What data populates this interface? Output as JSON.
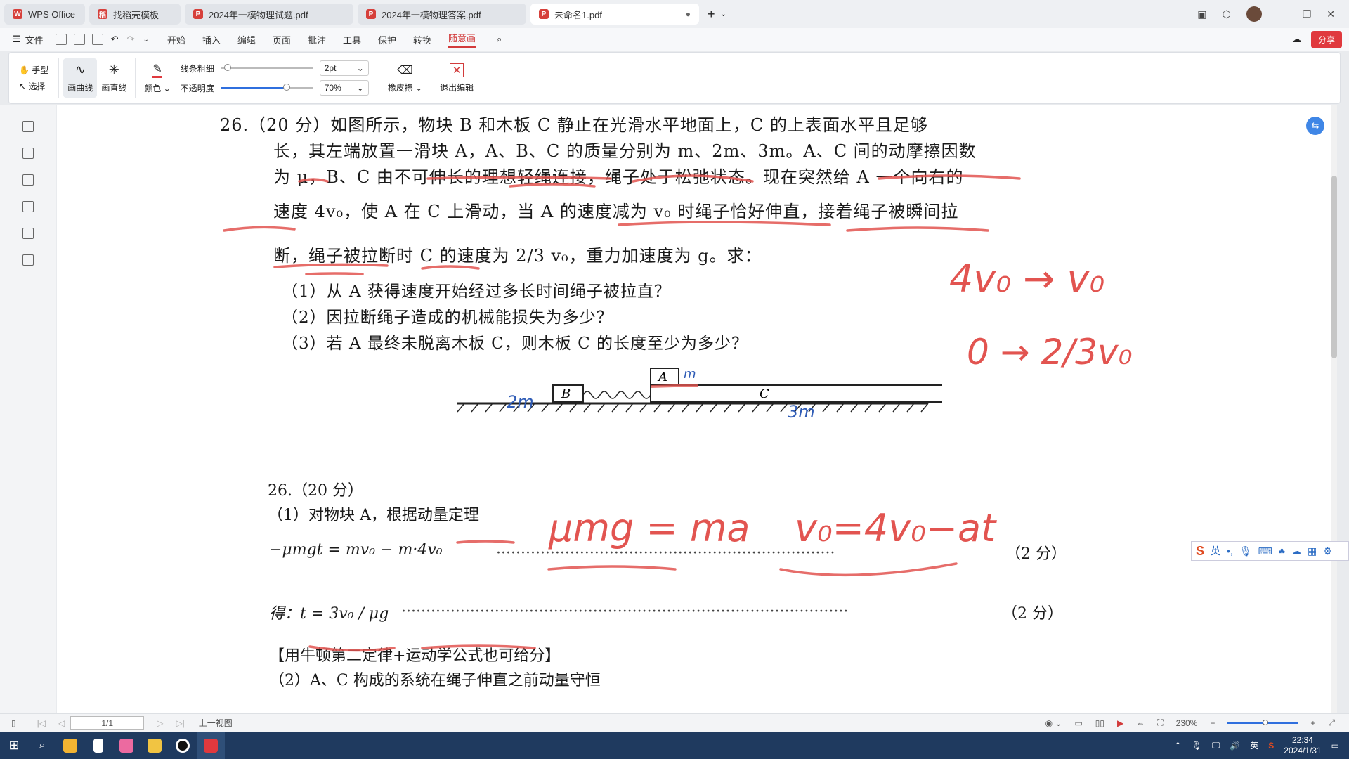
{
  "tabs": [
    {
      "label": "WPS Office"
    },
    {
      "label": "找稻壳模板"
    },
    {
      "label": "2024年一模物理试题.pdf"
    },
    {
      "label": "2024年一模物理答案.pdf"
    },
    {
      "label": "未命名1.pdf"
    }
  ],
  "menu": {
    "file": "文件",
    "items": [
      "开始",
      "插入",
      "编辑",
      "页面",
      "批注",
      "工具",
      "保护",
      "转换",
      "随意画"
    ],
    "share": "分享"
  },
  "ribbon": {
    "hand": "手型",
    "select": "选择",
    "curve": "画曲线",
    "line": "画直线",
    "color": "颜色",
    "thickness": "线条粗细",
    "opacity": "不透明度",
    "thickness_value": "2pt",
    "opacity_value": "70%",
    "opacity_level": 0.7,
    "eraser": "橡皮擦",
    "exit": "退出编辑"
  },
  "doc": {
    "q_line1": "26.（20 分）如图所示，物块 B 和木板 C 静止在光滑水平地面上，C 的上表面水平且足够",
    "q_line2": "长，其左端放置一滑块 A，A、B、C 的质量分别为 m、2m、3m。A、C 间的动摩擦因数",
    "q_line3": "为 μ，B、C 由不可伸长的理想轻绳连接，绳子处于松弛状态。现在突然给 A 一个向右的",
    "q_line4": "速度 4v₀，使 A 在 C 上滑动，当 A 的速度减为 v₀ 时绳子恰好伸直，接着绳子被瞬间拉",
    "q_line5": "断，绳子被拉断时 C 的速度为 2/3 v₀，重力加速度为 g。求：",
    "q_sub1": "（1）从 A 获得速度开始经过多长时间绳子被拉直？",
    "q_sub2": "（2）因拉断绳子造成的机械能损失为多少？",
    "q_sub3": "（3）若 A 最终未脱离木板 C，则木板 C 的长度至少为多少？",
    "fig_a": "A",
    "fig_b": "B",
    "fig_c": "C",
    "ans_head": "26.（20 分）",
    "ans_1": "（1）对物块 A，根据动量定理",
    "ans_eq1": "−μmgt = mv₀ − m·4v₀",
    "ans_pts": "（2 分）",
    "ans_get": "得：t = 3v₀ / μg",
    "ans_note": "【用牛顿第二定律+运动学公式也可给分】",
    "ans_2": "（2）A、C 构成的系统在绳子伸直之前动量守恒"
  },
  "ink": {
    "m_a": "m",
    "m_b": "2m",
    "m_c": "3m",
    "v1": "4v₀ → v₀",
    "v2": "0 → 2/3v₀",
    "eq1": "μmg = ma",
    "eq2": "v₀=4v₀−at"
  },
  "status": {
    "page": "1/1",
    "prev_view": "上一视图",
    "zoom": "230%"
  },
  "taskbar": {
    "time": "22:34",
    "date": "2024/1/31",
    "lang": "英"
  },
  "ime": {
    "lang": "英"
  }
}
